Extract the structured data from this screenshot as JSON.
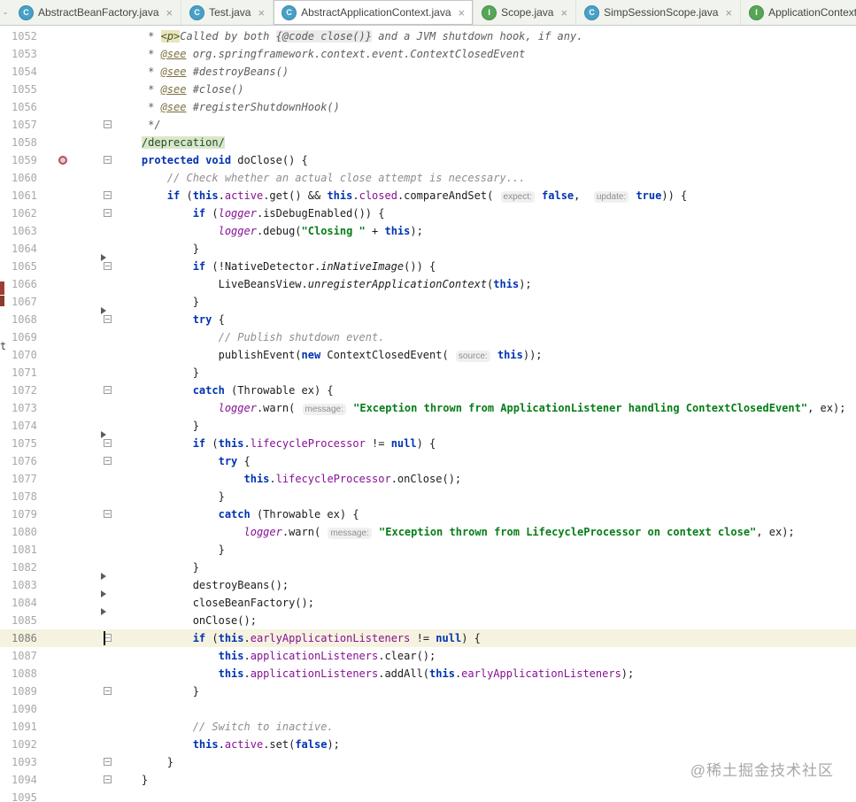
{
  "window": {
    "tab_prefix": "-",
    "left_edge_text": "t"
  },
  "tabbar": {
    "tabs": [
      {
        "label": "AbstractBeanFactory.java",
        "icon": "class",
        "icon_letter": "C",
        "close": "×",
        "active": false
      },
      {
        "label": "Test.java",
        "icon": "class",
        "icon_letter": "C",
        "close": "×",
        "active": false
      },
      {
        "label": "AbstractApplicationContext.java",
        "icon": "class",
        "icon_letter": "C",
        "close": "×",
        "active": true
      },
      {
        "label": "Scope.java",
        "icon": "interface",
        "icon_letter": "I",
        "close": "×",
        "active": false
      },
      {
        "label": "SimpSessionScope.java",
        "icon": "class",
        "icon_letter": "C",
        "close": "×",
        "active": false
      },
      {
        "label": "ApplicationContext.java",
        "icon": "interface",
        "icon_letter": "I",
        "close": "×",
        "active": false
      }
    ]
  },
  "colors": {
    "keyword": "#0033b3",
    "string": "#067d17",
    "field": "#871094",
    "comment": "#8e8e8e",
    "current_line_bg": "#f5f2e0",
    "folded_bg": "#d9e7cc",
    "class_icon": "#48a0c7",
    "interface_icon": "#57a657"
  },
  "watermark": "@稀土掘金技术社区",
  "editor": {
    "first_line": 1052,
    "last_line": 1095,
    "lines": [
      {
        "n": 1052,
        "segs": [
          [
            "doc",
            "     * "
          ],
          [
            "docmark",
            "<p>"
          ],
          [
            "doc",
            "Called by both "
          ],
          [
            "doccode",
            "{@code close()}"
          ],
          [
            "doc",
            " and a JVM shutdown hook, if any."
          ]
        ]
      },
      {
        "n": 1053,
        "segs": [
          [
            "doc",
            "     * "
          ],
          [
            "doctag",
            "@see"
          ],
          [
            "docval",
            " org.springframework.context.event.ContextClosedEvent"
          ]
        ]
      },
      {
        "n": 1054,
        "segs": [
          [
            "doc",
            "     * "
          ],
          [
            "doctag",
            "@see"
          ],
          [
            "docval",
            " #destroyBeans()"
          ]
        ]
      },
      {
        "n": 1055,
        "segs": [
          [
            "doc",
            "     * "
          ],
          [
            "doctag",
            "@see"
          ],
          [
            "docval",
            " #close()"
          ]
        ]
      },
      {
        "n": 1056,
        "segs": [
          [
            "doc",
            "     * "
          ],
          [
            "doctag",
            "@see"
          ],
          [
            "docval",
            " #registerShutdownHook()"
          ]
        ]
      },
      {
        "n": 1057,
        "sq": true,
        "segs": [
          [
            "doc",
            "     */"
          ]
        ]
      },
      {
        "n": 1058,
        "segs": [
          [
            "plain",
            "    "
          ],
          [
            "folded",
            "/deprecation/"
          ]
        ]
      },
      {
        "n": 1059,
        "sq": true,
        "icon": "override-circle",
        "segs": [
          [
            "plain",
            "    "
          ],
          [
            "kw",
            "protected"
          ],
          [
            "plain",
            " "
          ],
          [
            "kw",
            "void"
          ],
          [
            "plain",
            " doClose() {"
          ]
        ]
      },
      {
        "n": 1060,
        "segs": [
          [
            "plain",
            "        "
          ],
          [
            "comment",
            "// Check whether an actual close attempt is necessary..."
          ]
        ]
      },
      {
        "n": 1061,
        "sq": true,
        "segs": [
          [
            "plain",
            "        "
          ],
          [
            "kw",
            "if"
          ],
          [
            "plain",
            " ("
          ],
          [
            "kw",
            "this"
          ],
          [
            "plain",
            "."
          ],
          [
            "field",
            "active"
          ],
          [
            "plain",
            ".get() && "
          ],
          [
            "kw",
            "this"
          ],
          [
            "plain",
            "."
          ],
          [
            "field",
            "closed"
          ],
          [
            "plain",
            ".compareAndSet( "
          ],
          [
            "hint",
            "expect:"
          ],
          [
            "plain",
            " "
          ],
          [
            "kw",
            "false"
          ],
          [
            "plain",
            ",  "
          ],
          [
            "hint",
            "update:"
          ],
          [
            "plain",
            " "
          ],
          [
            "kw",
            "true"
          ],
          [
            "plain",
            ")) {"
          ]
        ]
      },
      {
        "n": 1062,
        "sq": true,
        "segs": [
          [
            "plain",
            "            "
          ],
          [
            "kw",
            "if"
          ],
          [
            "plain",
            " ("
          ],
          [
            "sfield",
            "logger"
          ],
          [
            "plain",
            ".isDebugEnabled()) {"
          ]
        ]
      },
      {
        "n": 1063,
        "segs": [
          [
            "plain",
            "                "
          ],
          [
            "sfield",
            "logger"
          ],
          [
            "plain",
            ".debug("
          ],
          [
            "str",
            "\"Closing \""
          ],
          [
            "plain",
            " + "
          ],
          [
            "kw",
            "this"
          ],
          [
            "plain",
            ");"
          ]
        ]
      },
      {
        "n": 1064,
        "segs": [
          [
            "plain",
            "            }"
          ]
        ]
      },
      {
        "n": 1065,
        "sq": true,
        "ar": true,
        "segs": [
          [
            "plain",
            "            "
          ],
          [
            "kw",
            "if"
          ],
          [
            "plain",
            " (!NativeDetector."
          ],
          [
            "smethod",
            "inNativeImage"
          ],
          [
            "plain",
            "()) {"
          ]
        ]
      },
      {
        "n": 1066,
        "segs": [
          [
            "plain",
            "                LiveBeansView."
          ],
          [
            "smethod",
            "unregisterApplicationContext"
          ],
          [
            "plain",
            "("
          ],
          [
            "kw",
            "this"
          ],
          [
            "plain",
            ");"
          ]
        ]
      },
      {
        "n": 1067,
        "segs": [
          [
            "plain",
            "            }"
          ]
        ]
      },
      {
        "n": 1068,
        "sq": true,
        "ar": true,
        "segs": [
          [
            "plain",
            "            "
          ],
          [
            "kw",
            "try"
          ],
          [
            "plain",
            " {"
          ]
        ]
      },
      {
        "n": 1069,
        "segs": [
          [
            "plain",
            "                "
          ],
          [
            "comment",
            "// Publish shutdown event."
          ]
        ]
      },
      {
        "n": 1070,
        "segs": [
          [
            "plain",
            "                publishEvent("
          ],
          [
            "kw",
            "new"
          ],
          [
            "plain",
            " ContextClosedEvent( "
          ],
          [
            "hint",
            "source:"
          ],
          [
            "plain",
            " "
          ],
          [
            "kw",
            "this"
          ],
          [
            "plain",
            "));"
          ]
        ]
      },
      {
        "n": 1071,
        "segs": [
          [
            "plain",
            "            }"
          ]
        ]
      },
      {
        "n": 1072,
        "sq": true,
        "segs": [
          [
            "plain",
            "            "
          ],
          [
            "kw",
            "catch"
          ],
          [
            "plain",
            " (Throwable ex) {"
          ]
        ]
      },
      {
        "n": 1073,
        "segs": [
          [
            "plain",
            "                "
          ],
          [
            "sfield",
            "logger"
          ],
          [
            "plain",
            ".warn( "
          ],
          [
            "hint",
            "message:"
          ],
          [
            "plain",
            " "
          ],
          [
            "str",
            "\"Exception thrown from ApplicationListener handling ContextClosedEvent\""
          ],
          [
            "plain",
            ", ex);"
          ]
        ]
      },
      {
        "n": 1074,
        "segs": [
          [
            "plain",
            "            }"
          ]
        ]
      },
      {
        "n": 1075,
        "sq": true,
        "ar": true,
        "segs": [
          [
            "plain",
            "            "
          ],
          [
            "kw",
            "if"
          ],
          [
            "plain",
            " ("
          ],
          [
            "kw",
            "this"
          ],
          [
            "plain",
            "."
          ],
          [
            "field",
            "lifecycleProcessor"
          ],
          [
            "plain",
            " != "
          ],
          [
            "kw",
            "null"
          ],
          [
            "plain",
            ") {"
          ]
        ]
      },
      {
        "n": 1076,
        "sq": true,
        "segs": [
          [
            "plain",
            "                "
          ],
          [
            "kw",
            "try"
          ],
          [
            "plain",
            " {"
          ]
        ]
      },
      {
        "n": 1077,
        "segs": [
          [
            "plain",
            "                    "
          ],
          [
            "kw",
            "this"
          ],
          [
            "plain",
            "."
          ],
          [
            "field",
            "lifecycleProcessor"
          ],
          [
            "plain",
            ".onClose();"
          ]
        ]
      },
      {
        "n": 1078,
        "segs": [
          [
            "plain",
            "                }"
          ]
        ]
      },
      {
        "n": 1079,
        "sq": true,
        "segs": [
          [
            "plain",
            "                "
          ],
          [
            "kw",
            "catch"
          ],
          [
            "plain",
            " (Throwable ex) {"
          ]
        ]
      },
      {
        "n": 1080,
        "segs": [
          [
            "plain",
            "                    "
          ],
          [
            "sfield",
            "logger"
          ],
          [
            "plain",
            ".warn( "
          ],
          [
            "hint",
            "message:"
          ],
          [
            "plain",
            " "
          ],
          [
            "str",
            "\"Exception thrown from LifecycleProcessor on context close\""
          ],
          [
            "plain",
            ", ex);"
          ]
        ]
      },
      {
        "n": 1081,
        "segs": [
          [
            "plain",
            "                }"
          ]
        ]
      },
      {
        "n": 1082,
        "segs": [
          [
            "plain",
            "            }"
          ]
        ]
      },
      {
        "n": 1083,
        "ar": true,
        "segs": [
          [
            "plain",
            "            destroyBeans();"
          ]
        ]
      },
      {
        "n": 1084,
        "ar": true,
        "segs": [
          [
            "plain",
            "            closeBeanFactory();"
          ]
        ]
      },
      {
        "n": 1085,
        "ar": true,
        "segs": [
          [
            "plain",
            "            onClose();"
          ]
        ]
      },
      {
        "n": 1086,
        "sq": true,
        "cur": true,
        "caret": true,
        "segs": [
          [
            "plain",
            "            "
          ],
          [
            "kw",
            "if"
          ],
          [
            "plain",
            " ("
          ],
          [
            "kw",
            "this"
          ],
          [
            "plain",
            "."
          ],
          [
            "field",
            "earlyApplicationListeners"
          ],
          [
            "plain",
            " != "
          ],
          [
            "kw",
            "null"
          ],
          [
            "plain",
            ") {"
          ]
        ]
      },
      {
        "n": 1087,
        "segs": [
          [
            "plain",
            "                "
          ],
          [
            "kw",
            "this"
          ],
          [
            "plain",
            "."
          ],
          [
            "field",
            "applicationListeners"
          ],
          [
            "plain",
            ".clear();"
          ]
        ]
      },
      {
        "n": 1088,
        "segs": [
          [
            "plain",
            "                "
          ],
          [
            "kw",
            "this"
          ],
          [
            "plain",
            "."
          ],
          [
            "field",
            "applicationListeners"
          ],
          [
            "plain",
            ".addAll("
          ],
          [
            "kw",
            "this"
          ],
          [
            "plain",
            "."
          ],
          [
            "field",
            "earlyApplicationListeners"
          ],
          [
            "plain",
            ");"
          ]
        ]
      },
      {
        "n": 1089,
        "sq": true,
        "segs": [
          [
            "plain",
            "            }"
          ]
        ]
      },
      {
        "n": 1090,
        "segs": []
      },
      {
        "n": 1091,
        "segs": [
          [
            "plain",
            "            "
          ],
          [
            "comment",
            "// Switch to inactive."
          ]
        ]
      },
      {
        "n": 1092,
        "segs": [
          [
            "plain",
            "            "
          ],
          [
            "kw",
            "this"
          ],
          [
            "plain",
            "."
          ],
          [
            "field",
            "active"
          ],
          [
            "plain",
            ".set("
          ],
          [
            "kw",
            "false"
          ],
          [
            "plain",
            ");"
          ]
        ]
      },
      {
        "n": 1093,
        "sq": true,
        "segs": [
          [
            "plain",
            "        }"
          ]
        ]
      },
      {
        "n": 1094,
        "sq": true,
        "segs": [
          [
            "plain",
            "    }"
          ]
        ]
      },
      {
        "n": 1095,
        "segs": []
      }
    ]
  }
}
